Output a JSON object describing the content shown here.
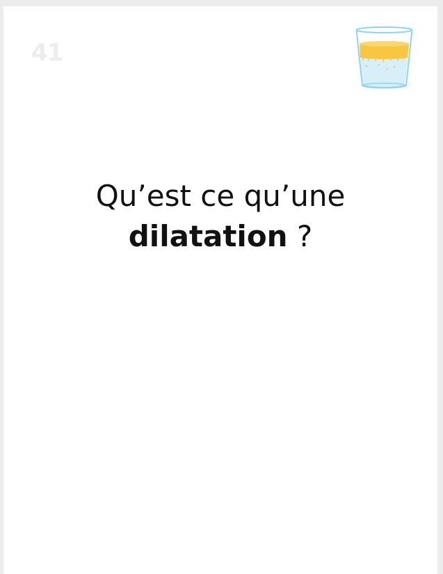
{
  "card": {
    "number": "41",
    "question_prefix": "Qu’est ce qu’une",
    "keyword": "dilatation",
    "question_suffix": " ?"
  },
  "illustration": {
    "icon": "glass-of-liquid-icon",
    "glass_color": "#8fd3ee",
    "liquid_color": "#f9c642",
    "water_color": "#d6eff9"
  },
  "colors": {
    "background": "#ececec",
    "card": "#ffffff",
    "number": "#ececec",
    "text": "#111111"
  }
}
